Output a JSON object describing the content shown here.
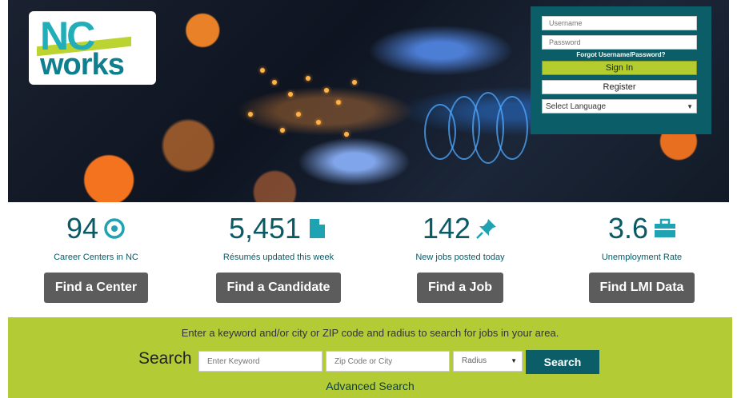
{
  "logo": {
    "line1": "NC",
    "line2": "works"
  },
  "login": {
    "username_placeholder": "Username",
    "password_placeholder": "Password",
    "forgot": "Forgot Username/Password?",
    "signin": "Sign In",
    "register": "Register",
    "language": "Select Language"
  },
  "stats": [
    {
      "number": "94",
      "label": "Career Centers in NC",
      "button": "Find a Center",
      "icon": "target-icon"
    },
    {
      "number": "5,451",
      "label": "Résumés updated this week",
      "button": "Find a Candidate",
      "icon": "document-icon"
    },
    {
      "number": "142",
      "label": "New jobs posted today",
      "button": "Find a Job",
      "icon": "pushpin-icon"
    },
    {
      "number": "3.6",
      "label": "Unemployment Rate",
      "button": "Find LMI Data",
      "icon": "briefcase-icon"
    }
  ],
  "search": {
    "intro": "Enter a keyword and/or city or ZIP code and radius to search for jobs in your area.",
    "label": "Search",
    "keyword_placeholder": "Enter Keyword",
    "zip_placeholder": "Zip Code or City",
    "radius": "Radius",
    "button": "Search",
    "advanced": "Advanced Search"
  },
  "colors": {
    "teal": "#0b5e67",
    "lime": "#b3cc36",
    "button_gray": "#5c5c5c",
    "stat_text": "#0a5a66",
    "icon_teal": "#1fa3b2"
  }
}
